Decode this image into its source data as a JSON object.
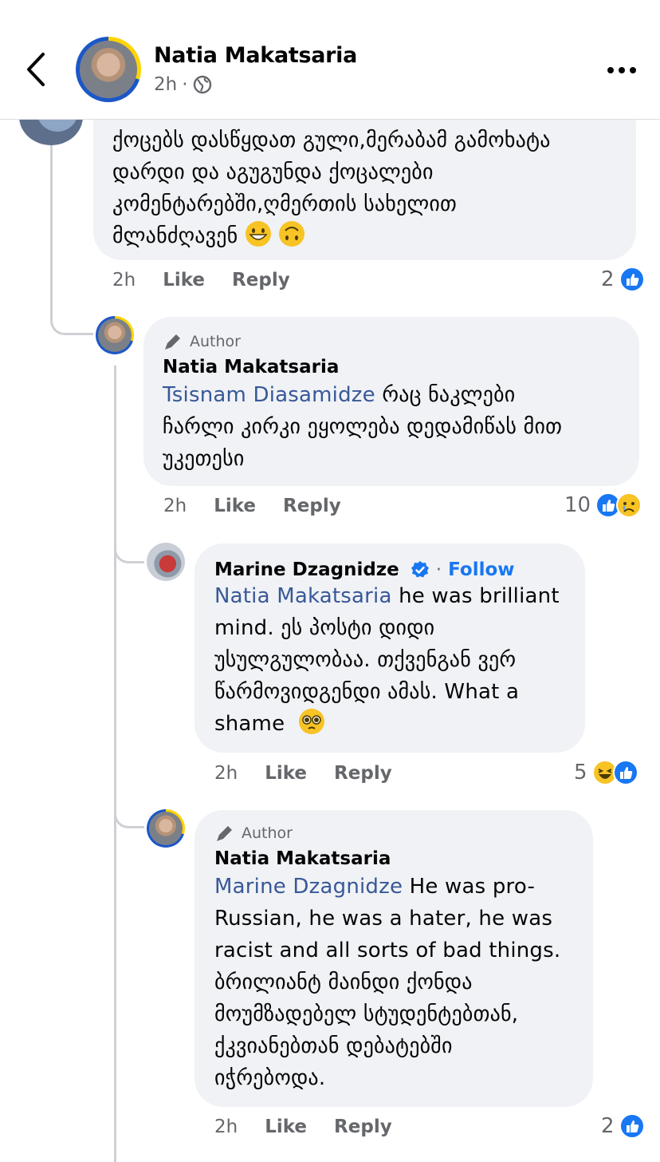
{
  "header": {
    "name": "Natia Makatsaria",
    "time": "2h",
    "dot": "·"
  },
  "comment_top": {
    "lines": [
      "ქოცებს დასწყდათ გული,მერაბამ გამოხატა",
      "დარდი და აგუგუნდა ქოცალები",
      "კომენტარებში,ღმერთის სახელით",
      "მლანძღავენ"
    ],
    "time": "2h",
    "like": "Like",
    "reply": "Reply",
    "reactions": "2"
  },
  "reply1": {
    "badge": "Author",
    "name": "Natia Makatsaria",
    "mention": "Tsisnam Diasamidze",
    "text_first": " რაც ნაკლები",
    "lines": [
      "ჩარლი კირკი ეყოლება დედამიწას მით",
      "უკეთესი"
    ],
    "time": "2h",
    "like": "Like",
    "reply": "Reply",
    "reactions": "10"
  },
  "reply2": {
    "name": "Marine Dzagnidze",
    "follow_sep": "·",
    "follow": "Follow",
    "mention": "Natia Makatsaria",
    "text_first": " he was brilliant",
    "lines": [
      "mind. ეს პოსტი დიდი",
      "უსულგულობაა. თქვენგან ვერ",
      "წარმოვიდგენდი ამას. What a",
      "shame"
    ],
    "time": "2h",
    "like": "Like",
    "reply": "Reply",
    "reactions": "5"
  },
  "reply3": {
    "badge": "Author",
    "name": "Natia Makatsaria",
    "mention": "Marine Dzagnidze",
    "text_first": " He was pro-",
    "lines": [
      "Russian,  he was a hater, he was",
      "racist and all sorts of bad things.",
      "ბრილიანტ მაინდი ქონდა",
      "მოუმზადებელ სტუდენტებთან,",
      "ქკვიანებთან დებატებში",
      "იჭრებოდა."
    ],
    "time": "2h",
    "like": "Like",
    "reply": "Reply",
    "reactions": "2"
  },
  "colors": {
    "like_blue": "#1877f2",
    "mention": "#385898",
    "bubble": "#f0f2f5",
    "meta": "#65676b"
  }
}
